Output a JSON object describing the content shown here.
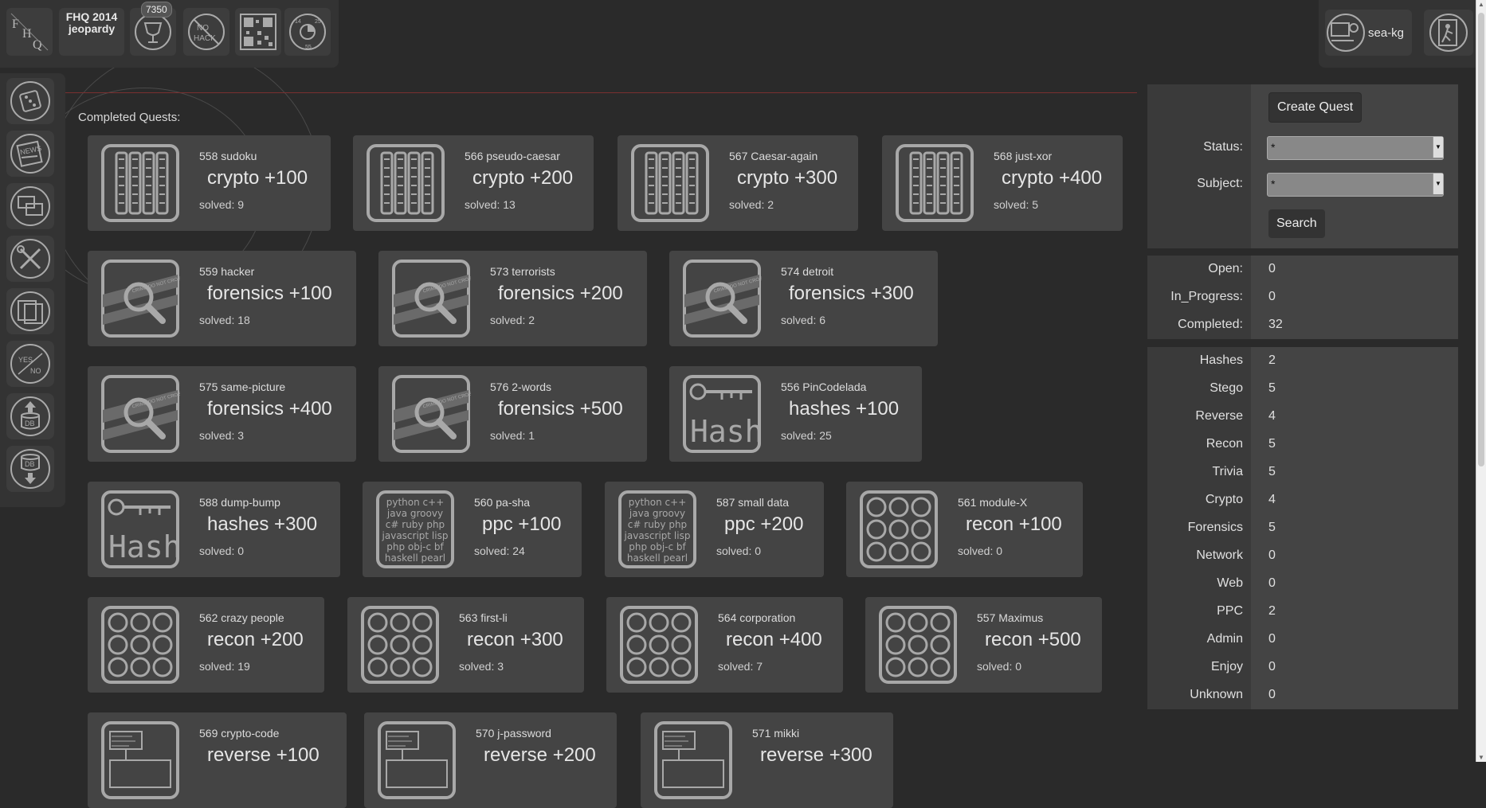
{
  "header": {
    "logo_line1": "FHQ 2014",
    "logo_line2": "jeopardy",
    "score_badge": "7350",
    "icons": [
      "fhq-logo-icon",
      "trophy-icon",
      "no-hack-icon",
      "qr-code-icon",
      "timer-clock-icon"
    ]
  },
  "user": {
    "name": "sea-kg",
    "icons": [
      "user-avatar-icon",
      "logout-icon"
    ]
  },
  "sidebar": {
    "items": [
      {
        "icon": "dice-icon"
      },
      {
        "icon": "news-icon"
      },
      {
        "icon": "chat-icon"
      },
      {
        "icon": "tools-icon"
      },
      {
        "icon": "documents-icon"
      },
      {
        "icon": "yes-no-icon"
      },
      {
        "icon": "db-upload-icon"
      },
      {
        "icon": "db-download-icon"
      }
    ]
  },
  "main": {
    "section_title": "Completed Quests:",
    "quests": [
      {
        "title": "558 sudoku",
        "score": "crypto +100",
        "solved": "solved: 9",
        "type": "crypto"
      },
      {
        "title": "566 pseudo-caesar",
        "score": "crypto +200",
        "solved": "solved: 13",
        "type": "crypto"
      },
      {
        "title": "567 Caesar-again",
        "score": "crypto +300",
        "solved": "solved: 2",
        "type": "crypto"
      },
      {
        "title": "568 just-xor",
        "score": "crypto +400",
        "solved": "solved: 5",
        "type": "crypto"
      },
      {
        "title": "559 hacker",
        "score": "forensics +100",
        "solved": "solved: 18",
        "type": "forensics"
      },
      {
        "title": "573 terrorists",
        "score": "forensics +200",
        "solved": "solved: 2",
        "type": "forensics"
      },
      {
        "title": "574 detroit",
        "score": "forensics +300",
        "solved": "solved: 6",
        "type": "forensics"
      },
      {
        "title": "575 same-picture",
        "score": "forensics +400",
        "solved": "solved: 3",
        "type": "forensics"
      },
      {
        "title": "576 2-words",
        "score": "forensics +500",
        "solved": "solved: 1",
        "type": "forensics"
      },
      {
        "title": "556 PinCodelada",
        "score": "hashes +100",
        "solved": "solved: 25",
        "type": "hashes"
      },
      {
        "title": "588 dump-bump",
        "score": "hashes +300",
        "solved": "solved: 0",
        "type": "hashes"
      },
      {
        "title": "560 pa-sha",
        "score": "ppc +100",
        "solved": "solved: 24",
        "type": "ppc"
      },
      {
        "title": "587 small data",
        "score": "ppc +200",
        "solved": "solved: 0",
        "type": "ppc"
      },
      {
        "title": "561 module-X",
        "score": "recon +100",
        "solved": "solved: 0",
        "type": "recon"
      },
      {
        "title": "562 crazy people",
        "score": "recon +200",
        "solved": "solved: 19",
        "type": "recon"
      },
      {
        "title": "563 first-li",
        "score": "recon +300",
        "solved": "solved: 3",
        "type": "recon"
      },
      {
        "title": "564 corporation",
        "score": "recon +400",
        "solved": "solved: 7",
        "type": "recon"
      },
      {
        "title": "557 Maximus",
        "score": "recon +500",
        "solved": "solved: 0",
        "type": "recon"
      },
      {
        "title": "569 crypto-code",
        "score": "reverse +100",
        "solved": "",
        "type": "reverse"
      },
      {
        "title": "570 j-password",
        "score": "reverse +200",
        "solved": "",
        "type": "reverse"
      },
      {
        "title": "571 mikki",
        "score": "reverse +300",
        "solved": "",
        "type": "reverse"
      }
    ],
    "ppc_icon_text": [
      "python c++",
      "java groovy",
      "c# ruby php",
      "javascript lisp",
      "php obj-c bf",
      "haskell pearl"
    ],
    "hash_icon_text": "Hash",
    "forensics_tape_text": "CRIME DO NOT CROSS"
  },
  "filter": {
    "create_label": "Create Quest",
    "status_label": "Status:",
    "status_value": "*",
    "subject_label": "Subject:",
    "subject_value": "*",
    "search_label": "Search"
  },
  "status_counts": [
    {
      "label": "Open:",
      "value": "0"
    },
    {
      "label": "In_Progress:",
      "value": "0"
    },
    {
      "label": "Completed:",
      "value": "32"
    }
  ],
  "subject_counts": [
    {
      "label": "Hashes",
      "value": "2"
    },
    {
      "label": "Stego",
      "value": "5"
    },
    {
      "label": "Reverse",
      "value": "4"
    },
    {
      "label": "Recon",
      "value": "5"
    },
    {
      "label": "Trivia",
      "value": "5"
    },
    {
      "label": "Crypto",
      "value": "4"
    },
    {
      "label": "Forensics",
      "value": "5"
    },
    {
      "label": "Network",
      "value": "0"
    },
    {
      "label": "Web",
      "value": "0"
    },
    {
      "label": "PPC",
      "value": "2"
    },
    {
      "label": "Admin",
      "value": "0"
    },
    {
      "label": "Enjoy",
      "value": "0"
    },
    {
      "label": "Unknown",
      "value": "0"
    }
  ],
  "colors": {
    "background": "#2a2a2a",
    "card": "#444444",
    "accent_line": "#7a3030",
    "icon_stroke": "#a8a8a8"
  }
}
